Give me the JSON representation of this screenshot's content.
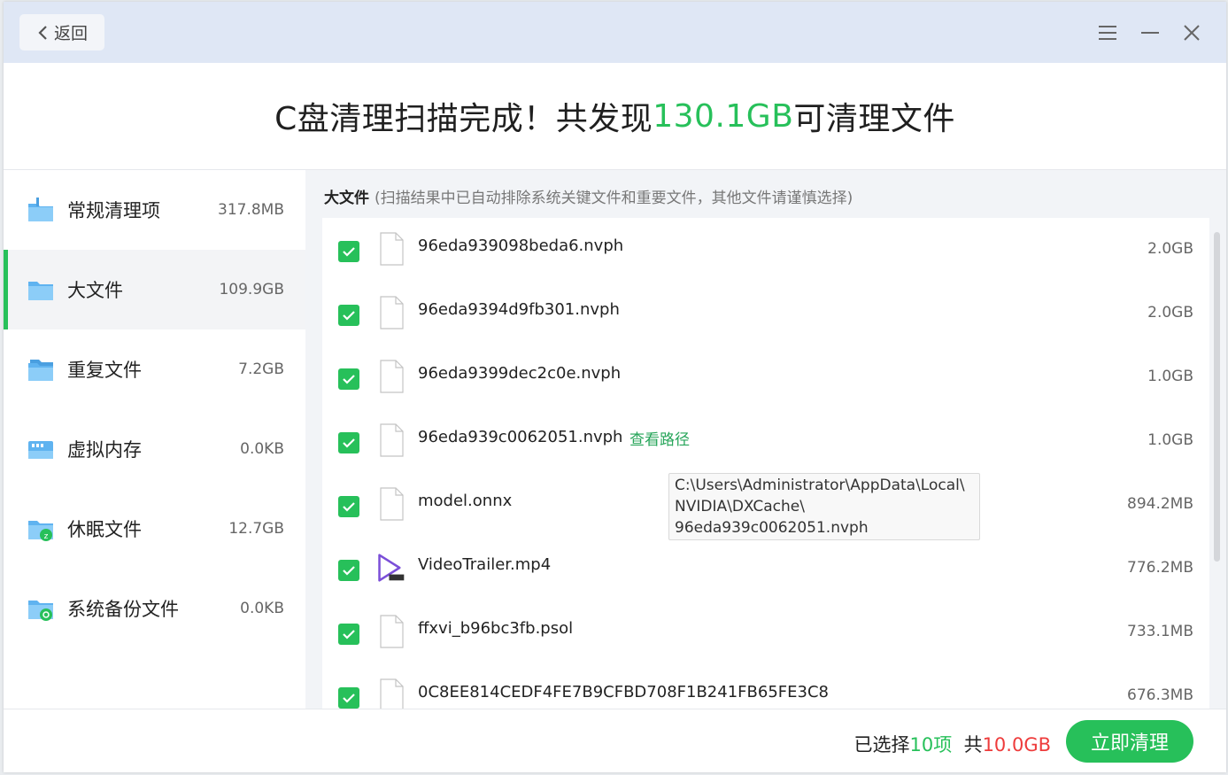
{
  "header": {
    "back_label": "返回"
  },
  "headline": {
    "prefix": "C盘清理扫描完成！共发现",
    "amount": "130.1GB",
    "suffix": "可清理文件"
  },
  "sidebar": {
    "items": [
      {
        "label": "常规清理项",
        "size": "317.8MB",
        "icon": "folder-broom-icon"
      },
      {
        "label": "大文件",
        "size": "109.9GB",
        "icon": "folder-icon"
      },
      {
        "label": "重复文件",
        "size": "7.2GB",
        "icon": "folder-duplicate-icon"
      },
      {
        "label": "虚拟内存",
        "size": "0.0KB",
        "icon": "memory-icon"
      },
      {
        "label": "休眠文件",
        "size": "12.7GB",
        "icon": "folder-sleep-icon"
      },
      {
        "label": "系统备份文件",
        "size": "0.0KB",
        "icon": "folder-backup-icon"
      }
    ],
    "active_index": 1
  },
  "section": {
    "title": "大文件",
    "note": "(扫描结果中已自动排除系统关键文件和重要文件，其他文件请谨慎选择)"
  },
  "files": [
    {
      "name": "96eda939098beda6.nvph",
      "size": "2.0GB",
      "icon": "file-icon"
    },
    {
      "name": "96eda9394d9fb301.nvph",
      "size": "2.0GB",
      "icon": "file-icon"
    },
    {
      "name": "96eda9399dec2c0e.nvph",
      "size": "1.0GB",
      "icon": "file-icon"
    },
    {
      "name": "96eda939c0062051.nvph",
      "size": "1.0GB",
      "icon": "file-icon"
    },
    {
      "name": "model.onnx",
      "size": "894.2MB",
      "icon": "file-icon"
    },
    {
      "name": "VideoTrailer.mp4",
      "size": "776.2MB",
      "icon": "video-file-icon"
    },
    {
      "name": "ffxvi_b96bc3fb.psol",
      "size": "733.1MB",
      "icon": "file-icon"
    },
    {
      "name": "0C8EE814CEDF4FE7B9CFBD708F1B241FB65FE3C8",
      "size": "676.3MB",
      "icon": "file-icon"
    }
  ],
  "view_path_label": "查看路径",
  "tooltip": {
    "line1": "C:\\Users\\Administrator\\AppData\\Local\\",
    "line2": "NVIDIA\\DXCache\\",
    "line3": "96eda939c0062051.nvph"
  },
  "footer": {
    "selected_prefix": "已选择",
    "selected_count": "10项",
    "total_prefix": "共",
    "total_size": "10.0GB",
    "clean_button": "立即清理"
  },
  "colors": {
    "accent_green": "#27c05a",
    "warning_red": "#ee3b3b",
    "titlebar_blue": "#dfe7f5"
  }
}
